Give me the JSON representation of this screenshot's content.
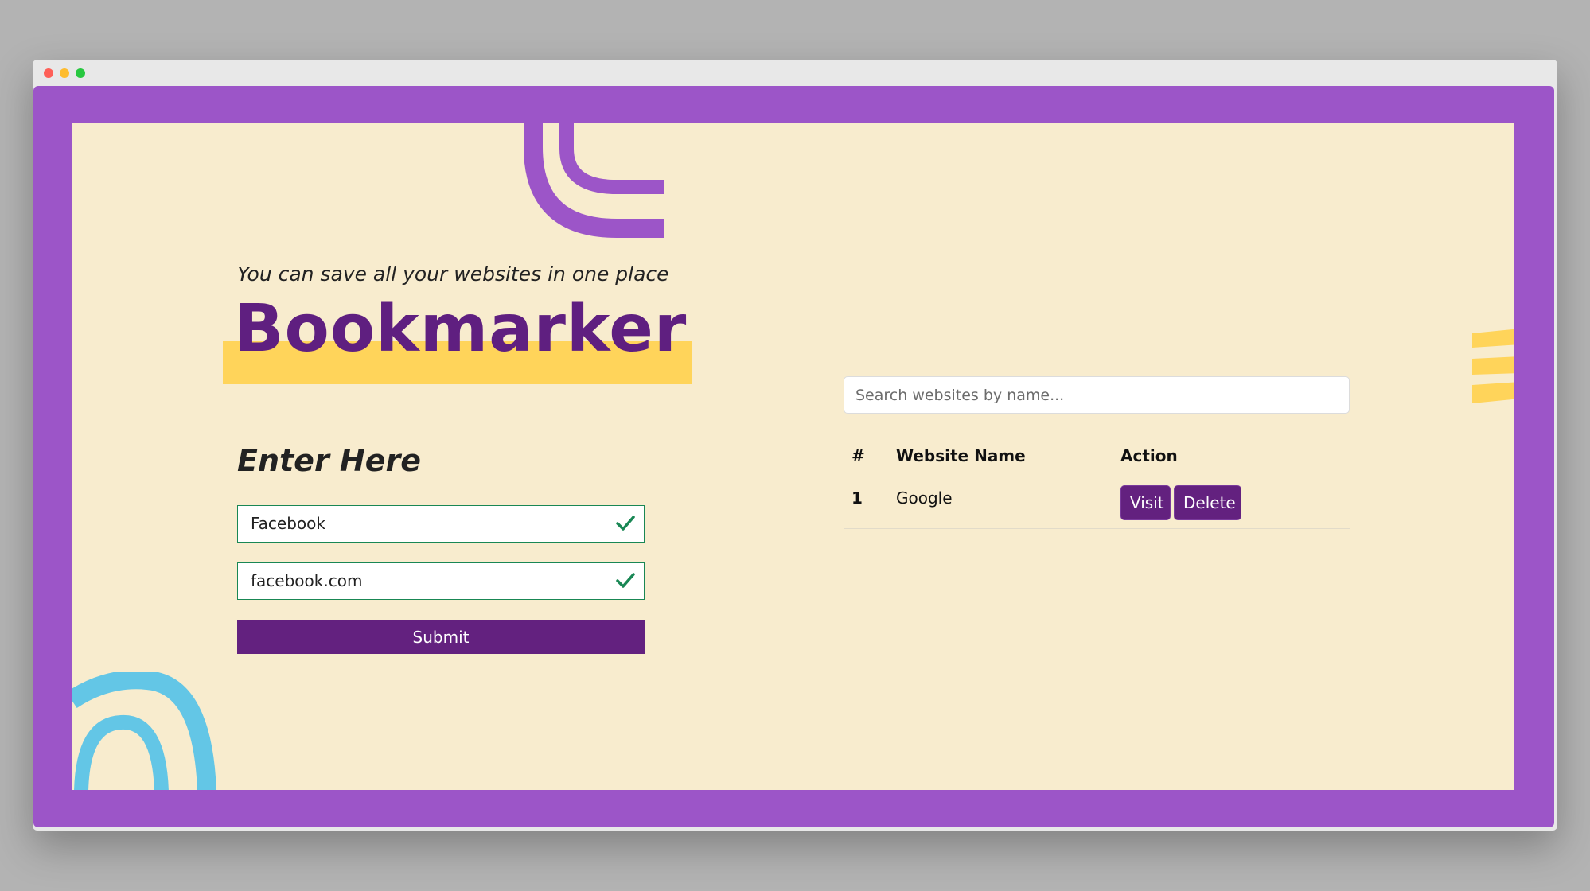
{
  "colors": {
    "frame": "#9c55c8",
    "canvas": "#f8ecce",
    "primary": "#63217f",
    "highlight": "#ffd45a",
    "valid": "#198754",
    "accent_blue": "#63c6e6"
  },
  "header": {
    "tagline": "You can save all your websites in one place",
    "brand": "Bookmarker"
  },
  "form": {
    "title": "Enter Here",
    "site_name_value": "Facebook",
    "site_url_value": "facebook.com",
    "submit_label": "Submit"
  },
  "search": {
    "placeholder": "Search websites by name..."
  },
  "table": {
    "headers": {
      "num": "#",
      "name": "Website Name",
      "action": "Action"
    },
    "rows": [
      {
        "num": "1",
        "name": "Google",
        "visit_label": "Visit",
        "delete_label": "Delete"
      }
    ]
  }
}
